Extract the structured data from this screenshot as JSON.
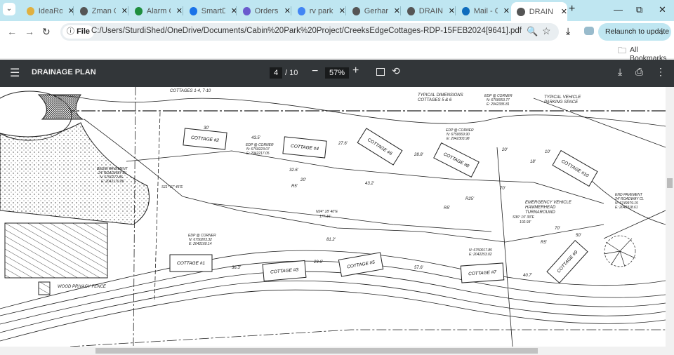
{
  "browser": {
    "tabs": [
      {
        "title": "IdeaRo",
        "icon": "idea-icon",
        "color": "#e0b040"
      },
      {
        "title": "Zman C",
        "icon": "globe-icon",
        "color": "#555"
      },
      {
        "title": "Alarm C",
        "icon": "sheets-icon",
        "color": "#1e8e3e"
      },
      {
        "title": "SmartD",
        "icon": "smart-icon",
        "color": "#1a73e8"
      },
      {
        "title": "Orders",
        "icon": "orders-icon",
        "color": "#6a5acd"
      },
      {
        "title": "rv park",
        "icon": "google-icon",
        "color": "#4285f4"
      },
      {
        "title": "Gerhar",
        "icon": "globe-icon",
        "color": "#555"
      },
      {
        "title": "DRAIN",
        "icon": "globe-icon",
        "color": "#555"
      },
      {
        "title": "Mail - C",
        "icon": "outlook-icon",
        "color": "#0f6cbd"
      },
      {
        "title": "DRAIN",
        "icon": "globe-icon",
        "color": "#555",
        "active": true
      }
    ],
    "file_chip": "File",
    "url": "C:/Users/SturdiShed/OneDrive/Documents/Cabin%20Park%20Project/CreeksEdgeCottages-RDP-15FEB2024[9641].pdf",
    "relaunch": "Relaunch to update",
    "all_bookmarks": "All Bookmarks"
  },
  "pdf": {
    "title": "DRAINAGE PLAN",
    "page": "4",
    "total": "/ 10",
    "zoom": "57%"
  },
  "drawing": {
    "cottages": [
      "COTTAGE #1",
      "COTTAGE #2",
      "COTTAGE #3",
      "COTTAGE #4",
      "COTTAGE #5",
      "COTTAGE #6",
      "COTTAGE #7",
      "COTTAGE #8",
      "COTTAGE #9",
      "COTTAGE #10"
    ],
    "notes": {
      "cottages_typ": "COTTAGES 1-4, 7-10",
      "typ_dim1": "TYPICAL DIMENSIONS",
      "typ_dim2": "COTTAGES 5 & 6",
      "typ_park1": "TYPICAL VEHICLE",
      "typ_park2": "PARKING SPACE",
      "edp1": "EDP @ CORNER",
      "edp1n": "N: 6750053.77",
      "edp1e": "E: 2042335.81",
      "edp2": "EDP @ CORNER",
      "edp2n": "N: 6750069.90",
      "edp2e": "E: 2042303.98",
      "edp3": "EDP @ CORNER",
      "edp3n": "N: 6750223.07",
      "edp3e": "E: 2042217.05",
      "edp4": "EDP @ CORNER",
      "edp4n": "N: 6750203.32",
      "edp4e": "E: 2042160.14",
      "edp5n": "N: 6750017.85",
      "edp5e": "E: 2042253.02",
      "begin1": "BEGIN PAVEMENT",
      "begin2": "24' ROADWAY CL",
      "begin3": "N: 6750272.86",
      "begin4": "E: 2042170.85",
      "end1": "END PAVEMENT",
      "end2": "24' ROADWAY CL",
      "end3": "N: 6749979.15",
      "end4": "E: 2042318.61",
      "emerg1": "EMERGENCY VEHICLE",
      "emerg2": "HAMMERHEAD",
      "emerg3": "TURNAROUND",
      "fence": "WOOD PRIVACY FENCE",
      "bearing1": "S11° 37' 45\"E",
      "bearing2": "N24° 18' 40\"E",
      "dist2": "177.16'",
      "bearing3": "S36° 15' 33\"E",
      "dist3": "102.93'"
    },
    "dims": [
      "30'",
      "43.5'",
      "27.6'",
      "28.8'",
      "32.6'",
      "20'",
      "43.2'",
      "20'",
      "18'",
      "10'",
      "70'",
      "81.2'",
      "36.3'",
      "29.6'",
      "57.6'",
      "40.7'",
      "70'",
      "50'",
      "R5'",
      "R5'",
      "R5'",
      "R25'"
    ]
  }
}
